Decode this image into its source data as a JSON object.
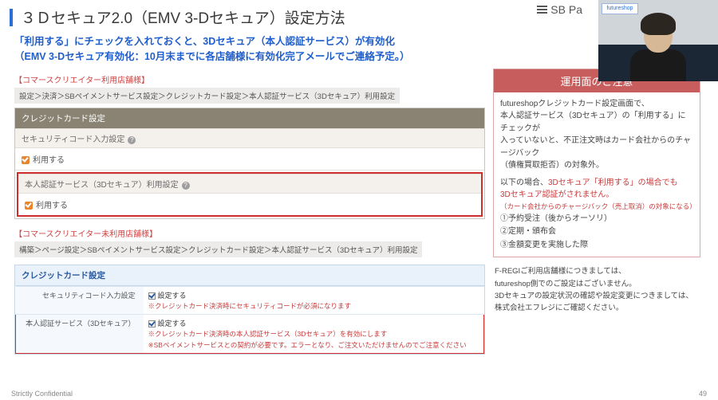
{
  "header": {
    "title": "３Ｄセキュア2.0（EMV 3-Dセキュア）設定方法",
    "logo_text": "SB Pa"
  },
  "webcam": {
    "tag": "futureshop"
  },
  "subhead": {
    "line1": "「利用する」にチェックを入れておくと、3Dセキュア（本人認証サービス）が有効化",
    "line2": "（EMV 3-Dセキュア有効化：10月末までに各店舗様に有効化完了メールでご連絡予定。）"
  },
  "section1": {
    "bracket": "【コマースクリエイター利用店舗様】",
    "breadcrumb": "設定＞決済＞SBペイメントサービス設定＞クレジットカード設定＞本人認証サービス（3Dセキュア）利用設定",
    "panel_title": "クレジットカード設定",
    "sec_code_label": "セキュリティコード入力設定",
    "use_label": "利用する",
    "auth_label": "本人認証サービス（3Dセキュア）利用設定",
    "q": "?"
  },
  "section2": {
    "bracket": "【コマースクリエイター未利用店舗様】",
    "breadcrumb": "構築＞ページ設定＞SBペイメントサービス設定＞クレジットカード設定＞本人認証サービス（3Dセキュア）利用設定",
    "panel_title": "クレジットカード設定",
    "row1_label": "セキュリティコード入力設定",
    "row1_check": "設定する",
    "row1_note": "※クレジットカード決済時にセキュリティコードが必須になります",
    "row2_label": "本人認証サービス（3Dセキュア）",
    "row2_check": "設定する",
    "row2_note1": "※クレジットカード決済時の本人認証サービス（3Dセキュア）を有効にします",
    "row2_note2": "※SBペイメントサービスとの契約が必要です。エラーとなり、ご注文いただけませんのでご注意ください"
  },
  "notice": {
    "title": "運用面のご注意",
    "p1a": "futureshopクレジットカード設定画面で、",
    "p1b": "本人認証サービス（3Dセキュア）の「利用する」にチェックが",
    "p1c": "入っていないと、不正注文時はカード会社からのチャージバック",
    "p1d": "（債権買取拒否）の対象外。",
    "p2a": "以下の場合、",
    "p2b": "3Dセキュア「利用する」の場合でも",
    "p2c": "3Dセキュア認証がされません。",
    "p2d": "（カード会社からのチャージバック（売上取消）の対象になる）",
    "i1": "①予約受注（後からオーソリ）",
    "i2": "②定期・頒布会",
    "i3": "③金額変更を実施した際"
  },
  "right_extra": {
    "l1": "F-REGIご利用店舗様につきましては、",
    "l2": "futureshop側でのご設定はございません。",
    "l3": "3Dセキュアの設定状況の確認や設定変更につきましては、",
    "l4": "株式会社エフレジにご確認ください。"
  },
  "footer": {
    "left": "Strictly Confidential",
    "page": "49"
  }
}
